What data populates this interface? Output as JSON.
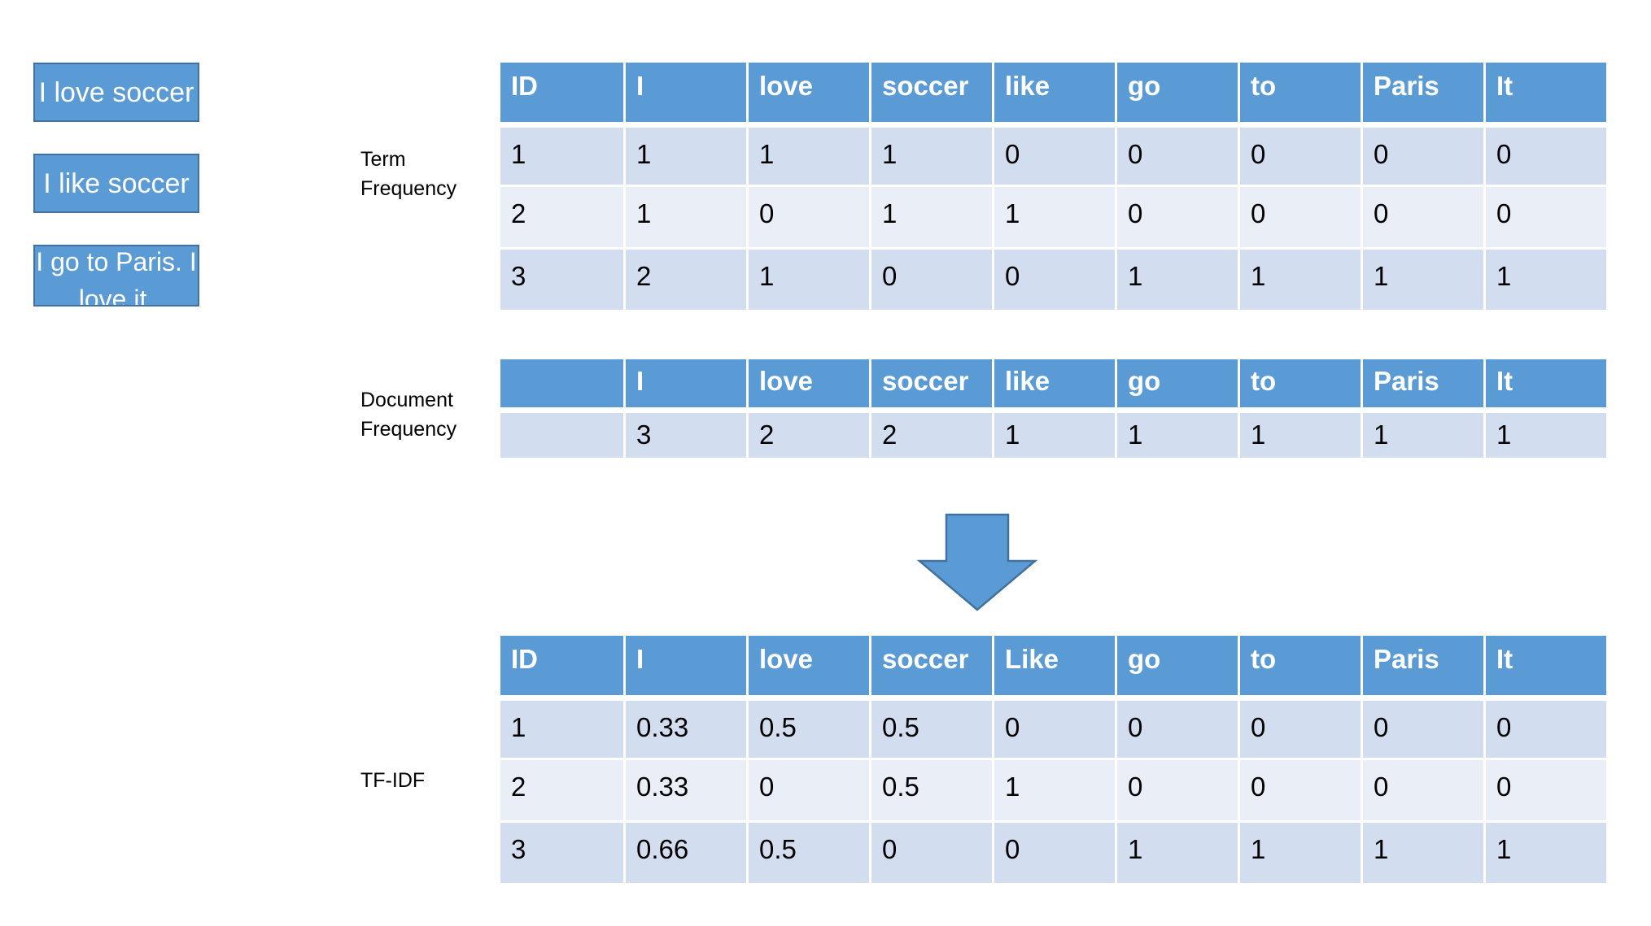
{
  "documents": [
    {
      "id": 1,
      "text": "I love soccer"
    },
    {
      "id": 2,
      "text": "I like soccer"
    },
    {
      "id": 3,
      "text": "I go to Paris. I love it."
    }
  ],
  "labels": {
    "term_frequency": [
      "Term",
      "Frequency"
    ],
    "document_frequency": [
      "Document",
      "Frequency"
    ],
    "tfidf": "TF-IDF"
  },
  "term_frequency_table": {
    "headers": [
      "ID",
      "I",
      "love",
      "soccer",
      "like",
      "go",
      "to",
      "Paris",
      "It"
    ],
    "rows": [
      [
        "1",
        "1",
        "1",
        "1",
        "0",
        "0",
        "0",
        "0",
        "0"
      ],
      [
        "2",
        "1",
        "0",
        "1",
        "1",
        "0",
        "0",
        "0",
        "0"
      ],
      [
        "3",
        "2",
        "1",
        "0",
        "0",
        "1",
        "1",
        "1",
        "1"
      ]
    ]
  },
  "document_frequency_table": {
    "headers": [
      "",
      "I",
      "love",
      "soccer",
      "like",
      "go",
      "to",
      "Paris",
      "It"
    ],
    "rows": [
      [
        "",
        "3",
        "2",
        "2",
        "1",
        "1",
        "1",
        "1",
        "1"
      ]
    ]
  },
  "tfidf_table": {
    "headers": [
      "ID",
      "I",
      "love",
      "soccer",
      "Like",
      "go",
      "to",
      "Paris",
      "It"
    ],
    "rows": [
      [
        "1",
        "0.33",
        "0.5",
        "0.5",
        "0",
        "0",
        "0",
        "0",
        "0"
      ],
      [
        "2",
        "0.33",
        "0",
        "0.5",
        "1",
        "0",
        "0",
        "0",
        "0"
      ],
      [
        "3",
        "0.66",
        "0.5",
        "0",
        "0",
        "1",
        "1",
        "1",
        "1"
      ]
    ]
  },
  "arrow": {
    "icon": "down-arrow-icon",
    "meaning": "transforms into"
  },
  "colors": {
    "header_fill": "#5b9bd5",
    "row_odd_fill": "#d2deef",
    "row_even_fill": "#eaeff7",
    "box_border": "#41719c"
  }
}
